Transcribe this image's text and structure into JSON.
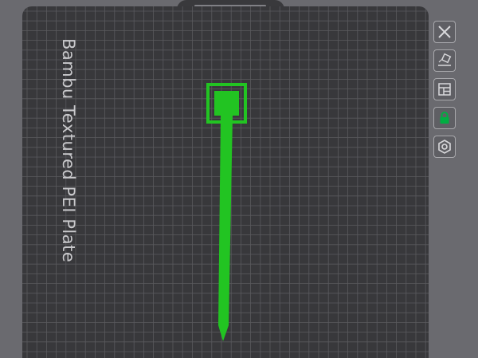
{
  "plate": {
    "label": "Bambu Textured PEI Plate"
  },
  "toolbar": {
    "buttons": [
      {
        "name": "close-plate-button",
        "icon": "close-icon"
      },
      {
        "name": "auto-orient-button",
        "icon": "orient-icon"
      },
      {
        "name": "arrange-button",
        "icon": "arrange-icon"
      },
      {
        "name": "lock-plate-button",
        "icon": "lock-icon"
      },
      {
        "name": "plate-settings-button",
        "icon": "gear-icon"
      }
    ]
  },
  "colors": {
    "plate_bg": "#38383b",
    "grid_line": "#5a5a5e",
    "model_green": "#22c422",
    "lock_green": "#00ae42",
    "outer_bg": "#6a6a6f"
  }
}
